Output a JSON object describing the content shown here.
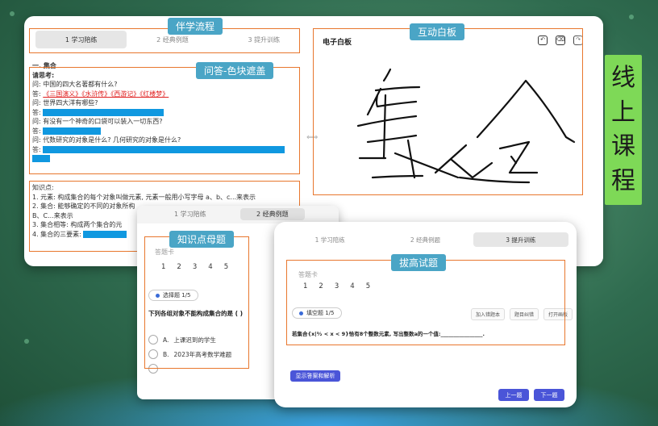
{
  "side_title": [
    "线",
    "上",
    "课",
    "程"
  ],
  "callouts": {
    "flow": "伴学流程",
    "qa_mask": "问答-色块遮盖",
    "whiteboard": "互动白板",
    "knowledge": "知识点母题",
    "advanced": "拔高试题"
  },
  "main": {
    "tabs": [
      "1 学习陪练",
      "2 经典例题",
      "3 提升训练"
    ],
    "section_title": "一. 集合",
    "think_label": "请思考:",
    "qa": [
      {
        "q": "问:  中国的四大名著都有什么?",
        "a_prefix": "答:  ",
        "a_red": "《三国演义》《水浒传》《西游记》《红楼梦》"
      },
      {
        "q": "问:  世界四大洋有哪些?",
        "a_prefix": "答:"
      },
      {
        "q": "问:  有没有一个神奇的口袋可以装入一切东西?",
        "a_prefix": "答:"
      },
      {
        "q": "问:  代数研究的对象是什么? 几何研究的对象是什么?",
        "a_prefix": "答:"
      }
    ],
    "knowledge_title": "知识点:",
    "knowledge": [
      "1. 元素: 构成集合的每个对象叫做元素, 元素一般用小写字母 a、b、c...来表示",
      "2. 集合: 能够确定的不同的对象所构",
      "B、C...来表示",
      "3. 集合相等: 构成两个集合的元",
      "4. 集合的三要素:"
    ],
    "whiteboard_title": "电子白板",
    "whiteboard_icons": [
      "undo-icon",
      "trash-icon",
      "redo-icon"
    ],
    "strokes_colour": "#111111"
  },
  "win2": {
    "tabs": [
      "1 学习陪练",
      "2 经典例题",
      "3 提升训练"
    ],
    "answer_card": "答题卡",
    "numbers": [
      "1",
      "2",
      "3",
      "4",
      "5"
    ],
    "badge": "选择题 1/5",
    "question": "下列各组对象不能构成集合的是 (     )",
    "options": [
      {
        "letter": "A.",
        "text": "上课迟到的学生"
      },
      {
        "letter": "B.",
        "text": "2023年高考数学难题"
      }
    ]
  },
  "win3": {
    "tabs": [
      "1 学习陪练",
      "2 经典例题",
      "3 提升训练"
    ],
    "answer_card": "答题卡",
    "numbers": [
      "1",
      "2",
      "3",
      "4",
      "5"
    ],
    "badge": "填空题 1/5",
    "tools": [
      "加入错题本",
      "题目纠错",
      "打开画板"
    ],
    "question": "若集合{x|⁵⁄₂ < x < 9}恰有8个整数元素, 写出整数a的一个值:________________.",
    "show_answer": "显示答案和解析",
    "prev": "上一题",
    "next": "下一题"
  },
  "colors": {
    "accent_orange": "#e8772e",
    "callout_blue": "#4aa5c6",
    "mask_blue": "#1098e0",
    "side_green": "#7ed957",
    "button_purple": "#4a55d8"
  }
}
